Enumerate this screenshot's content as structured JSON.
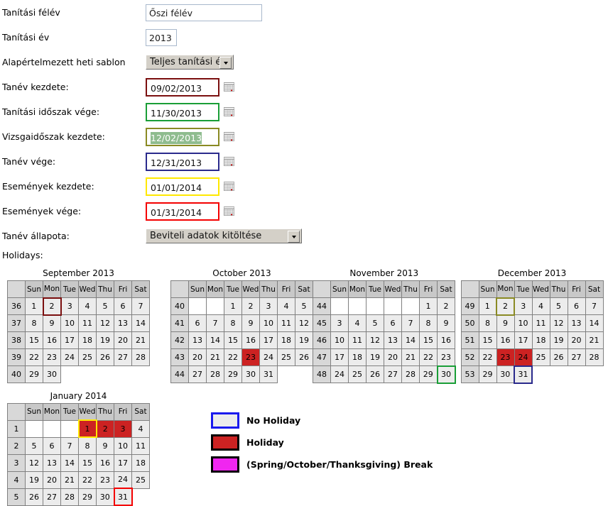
{
  "form": {
    "rows": [
      {
        "label": "Tanítási félév",
        "value": "Őszi félév",
        "kind": "text"
      },
      {
        "label": "Tanítási év",
        "value": "2013",
        "kind": "text"
      },
      {
        "label": "Alapértelmezett heti sablon",
        "value": "Teljes tanítási év",
        "kind": "select"
      },
      {
        "label": "Tanév kezdete:",
        "value": "09/02/2013",
        "kind": "date",
        "border": "#7b0f0f"
      },
      {
        "label": "Tanítási időszak vége:",
        "value": "11/30/2013",
        "kind": "date",
        "border": "#1a9e37"
      },
      {
        "label": "Vizsgaidőszak kezdete:",
        "value": "12/02/2013",
        "kind": "date",
        "border": "#8a8a23",
        "selected": true
      },
      {
        "label": "Tanév vége:",
        "value": "12/31/2013",
        "kind": "date",
        "border": "#2a2a8c"
      },
      {
        "label": "Események kezdete:",
        "value": "01/01/2014",
        "kind": "date",
        "border": "#ffe800"
      },
      {
        "label": "Események vége:",
        "value": "01/31/2014",
        "kind": "date",
        "border": "#f40000"
      },
      {
        "label": "Tanév állapota:",
        "value": "Beviteli adatok kitöltése",
        "kind": "select"
      }
    ],
    "holidays_label": "Holidays:",
    "calendar_icon": "calendar-picker-icon"
  },
  "calendars": {
    "dow": [
      "Sun",
      "Mon",
      "Tue",
      "Wed",
      "Thu",
      "Fri",
      "Sat"
    ],
    "months": [
      {
        "title": "September 2013",
        "weeks": [
          {
            "no": "36",
            "days": [
              {
                "d": "1"
              },
              {
                "d": "2",
                "mark": "#7b0f0f"
              },
              {
                "d": "3"
              },
              {
                "d": "4"
              },
              {
                "d": "5"
              },
              {
                "d": "6"
              },
              {
                "d": "7"
              }
            ]
          },
          {
            "no": "37",
            "days": [
              {
                "d": "8"
              },
              {
                "d": "9"
              },
              {
                "d": "10"
              },
              {
                "d": "11"
              },
              {
                "d": "12"
              },
              {
                "d": "13"
              },
              {
                "d": "14"
              }
            ]
          },
          {
            "no": "38",
            "days": [
              {
                "d": "15"
              },
              {
                "d": "16"
              },
              {
                "d": "17"
              },
              {
                "d": "18"
              },
              {
                "d": "19"
              },
              {
                "d": "20"
              },
              {
                "d": "21"
              }
            ]
          },
          {
            "no": "39",
            "days": [
              {
                "d": "22"
              },
              {
                "d": "23"
              },
              {
                "d": "24"
              },
              {
                "d": "25"
              },
              {
                "d": "26"
              },
              {
                "d": "27"
              },
              {
                "d": "28"
              }
            ]
          },
          {
            "no": "40",
            "days": [
              {
                "d": "29"
              },
              {
                "d": "30"
              },
              {
                "t": true
              },
              {
                "t": true
              },
              {
                "t": true
              },
              {
                "t": true
              },
              {
                "t": true
              }
            ]
          }
        ]
      },
      {
        "title": "October 2013",
        "weeks": [
          {
            "no": "40",
            "days": [
              {
                "e": true
              },
              {
                "e": true
              },
              {
                "d": "1"
              },
              {
                "d": "2"
              },
              {
                "d": "3"
              },
              {
                "d": "4"
              },
              {
                "d": "5"
              }
            ]
          },
          {
            "no": "41",
            "days": [
              {
                "d": "6"
              },
              {
                "d": "7"
              },
              {
                "d": "8"
              },
              {
                "d": "9"
              },
              {
                "d": "10"
              },
              {
                "d": "11"
              },
              {
                "d": "12"
              }
            ]
          },
          {
            "no": "42",
            "days": [
              {
                "d": "13"
              },
              {
                "d": "14"
              },
              {
                "d": "15"
              },
              {
                "d": "16"
              },
              {
                "d": "17"
              },
              {
                "d": "18"
              },
              {
                "d": "19"
              }
            ]
          },
          {
            "no": "43",
            "days": [
              {
                "d": "20"
              },
              {
                "d": "21"
              },
              {
                "d": "22"
              },
              {
                "d": "23",
                "holiday": true
              },
              {
                "d": "24"
              },
              {
                "d": "25"
              },
              {
                "d": "26"
              }
            ]
          },
          {
            "no": "44",
            "days": [
              {
                "d": "27"
              },
              {
                "d": "28"
              },
              {
                "d": "29"
              },
              {
                "d": "30"
              },
              {
                "d": "31"
              },
              {
                "t": true
              },
              {
                "t": true
              }
            ]
          }
        ]
      },
      {
        "title": "November 2013",
        "weeks": [
          {
            "no": "44",
            "days": [
              {
                "e": true
              },
              {
                "e": true
              },
              {
                "e": true
              },
              {
                "e": true
              },
              {
                "e": true
              },
              {
                "d": "1"
              },
              {
                "d": "2"
              }
            ]
          },
          {
            "no": "45",
            "days": [
              {
                "d": "3"
              },
              {
                "d": "4"
              },
              {
                "d": "5"
              },
              {
                "d": "6"
              },
              {
                "d": "7"
              },
              {
                "d": "8"
              },
              {
                "d": "9"
              }
            ]
          },
          {
            "no": "46",
            "days": [
              {
                "d": "10"
              },
              {
                "d": "11"
              },
              {
                "d": "12"
              },
              {
                "d": "13"
              },
              {
                "d": "14"
              },
              {
                "d": "15"
              },
              {
                "d": "16"
              }
            ]
          },
          {
            "no": "47",
            "days": [
              {
                "d": "17"
              },
              {
                "d": "18"
              },
              {
                "d": "19"
              },
              {
                "d": "20"
              },
              {
                "d": "21"
              },
              {
                "d": "22"
              },
              {
                "d": "23"
              }
            ]
          },
          {
            "no": "48",
            "days": [
              {
                "d": "24"
              },
              {
                "d": "25"
              },
              {
                "d": "26"
              },
              {
                "d": "27"
              },
              {
                "d": "28"
              },
              {
                "d": "29"
              },
              {
                "d": "30",
                "mark": "#1a9e37"
              }
            ]
          }
        ]
      },
      {
        "title": "December 2013",
        "weeks": [
          {
            "no": "49",
            "days": [
              {
                "d": "1"
              },
              {
                "d": "2",
                "mark": "#8a8a23"
              },
              {
                "d": "3"
              },
              {
                "d": "4"
              },
              {
                "d": "5"
              },
              {
                "d": "6"
              },
              {
                "d": "7"
              }
            ]
          },
          {
            "no": "50",
            "days": [
              {
                "d": "8"
              },
              {
                "d": "9"
              },
              {
                "d": "10"
              },
              {
                "d": "11"
              },
              {
                "d": "12"
              },
              {
                "d": "13"
              },
              {
                "d": "14"
              }
            ]
          },
          {
            "no": "51",
            "days": [
              {
                "d": "15"
              },
              {
                "d": "16"
              },
              {
                "d": "17"
              },
              {
                "d": "18"
              },
              {
                "d": "19"
              },
              {
                "d": "20"
              },
              {
                "d": "21"
              }
            ]
          },
          {
            "no": "52",
            "days": [
              {
                "d": "22"
              },
              {
                "d": "23",
                "holiday": true
              },
              {
                "d": "24",
                "holiday": true
              },
              {
                "d": "25"
              },
              {
                "d": "26"
              },
              {
                "d": "27"
              },
              {
                "d": "28"
              }
            ]
          },
          {
            "no": "53",
            "days": [
              {
                "d": "29"
              },
              {
                "d": "30"
              },
              {
                "d": "31",
                "mark": "#2a2a8c"
              },
              {
                "t": true
              },
              {
                "t": true
              },
              {
                "t": true
              },
              {
                "t": true
              }
            ]
          }
        ]
      },
      {
        "title": "January 2014",
        "weeks": [
          {
            "no": "1",
            "days": [
              {
                "e": true
              },
              {
                "e": true
              },
              {
                "e": true
              },
              {
                "d": "1",
                "holiday": true,
                "mark": "#ffe800"
              },
              {
                "d": "2",
                "holiday": true
              },
              {
                "d": "3",
                "holiday": true
              },
              {
                "d": "4"
              }
            ]
          },
          {
            "no": "2",
            "days": [
              {
                "d": "5"
              },
              {
                "d": "6"
              },
              {
                "d": "7"
              },
              {
                "d": "8"
              },
              {
                "d": "9"
              },
              {
                "d": "10"
              },
              {
                "d": "11"
              }
            ]
          },
          {
            "no": "3",
            "days": [
              {
                "d": "12"
              },
              {
                "d": "13"
              },
              {
                "d": "14"
              },
              {
                "d": "15"
              },
              {
                "d": "16"
              },
              {
                "d": "17"
              },
              {
                "d": "18"
              }
            ]
          },
          {
            "no": "4",
            "days": [
              {
                "d": "19"
              },
              {
                "d": "20"
              },
              {
                "d": "21"
              },
              {
                "d": "22"
              },
              {
                "d": "23"
              },
              {
                "d": "24"
              },
              {
                "d": "25"
              }
            ]
          },
          {
            "no": "5",
            "days": [
              {
                "d": "26"
              },
              {
                "d": "27"
              },
              {
                "d": "28"
              },
              {
                "d": "29"
              },
              {
                "d": "30"
              },
              {
                "d": "31",
                "mark": "#f40000"
              },
              {
                "t": true
              }
            ]
          }
        ]
      }
    ]
  },
  "legend": [
    {
      "label": "No Holiday",
      "fill": "#ececec",
      "border": "#1a1aee"
    },
    {
      "label": "Holiday",
      "fill": "#cc2222",
      "border": "#000000"
    },
    {
      "label": "(Spring/October/Thanksgiving) Break",
      "fill": "#f026f0",
      "border": "#000000"
    }
  ]
}
